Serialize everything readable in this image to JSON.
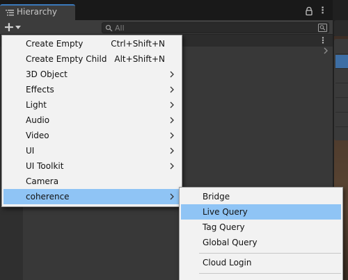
{
  "hierarchy": {
    "tab_title": "Hierarchy",
    "search_placeholder": "All"
  },
  "context_menu": {
    "items": [
      {
        "label": "Create Empty",
        "shortcut": "Ctrl+Shift+N",
        "submenu": false
      },
      {
        "label": "Create Empty Child",
        "shortcut": "Alt+Shift+N",
        "submenu": false
      },
      {
        "label": "3D Object",
        "shortcut": "",
        "submenu": true
      },
      {
        "label": "Effects",
        "shortcut": "",
        "submenu": true
      },
      {
        "label": "Light",
        "shortcut": "",
        "submenu": true
      },
      {
        "label": "Audio",
        "shortcut": "",
        "submenu": true
      },
      {
        "label": "Video",
        "shortcut": "",
        "submenu": true
      },
      {
        "label": "UI",
        "shortcut": "",
        "submenu": true
      },
      {
        "label": "UI Toolkit",
        "shortcut": "",
        "submenu": true
      },
      {
        "label": "Camera",
        "shortcut": "",
        "submenu": false
      },
      {
        "label": "coherence",
        "shortcut": "",
        "submenu": true,
        "selected": true
      }
    ]
  },
  "submenu": {
    "items": [
      {
        "label": "Bridge"
      },
      {
        "label": "Live Query",
        "selected": true
      },
      {
        "label": "Tag Query"
      },
      {
        "label": "Global Query"
      },
      {
        "label": "Cloud Login"
      }
    ]
  },
  "colors": {
    "accent": "#3a79bb",
    "selection": "#8fc4f5",
    "menu_bg": "#f2f2f2",
    "panel_bg": "#383838"
  },
  "icons": {
    "tab": "list-icon",
    "lock": "lock-icon",
    "more": "kebab-menu-icon",
    "add": "plus-icon",
    "search": "search-icon",
    "search_type": "search-type-icon",
    "submenu": "chevron-right-icon"
  }
}
